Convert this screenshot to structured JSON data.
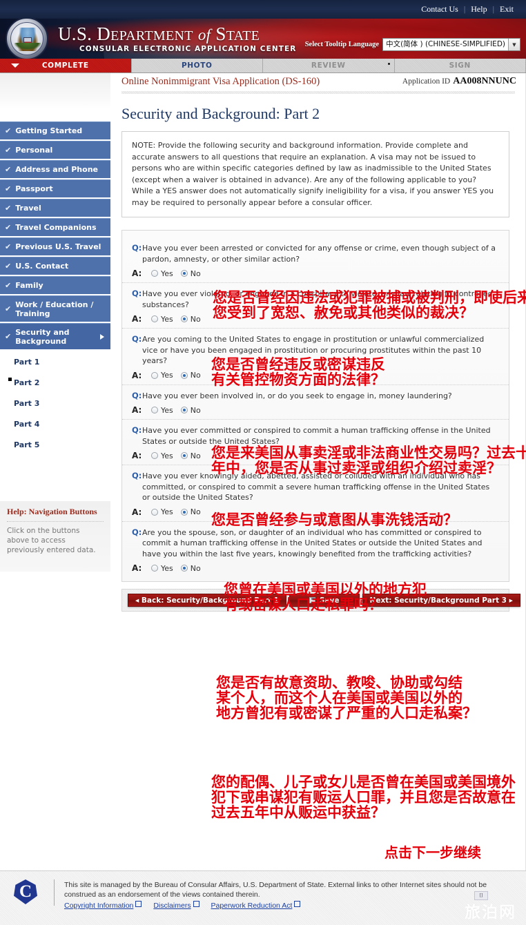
{
  "topbar": {
    "links": [
      "Contact Us",
      "Help",
      "Exit"
    ]
  },
  "banner": {
    "title_prefix": "U.S. D",
    "title_epartment": "EPARTMENT",
    "title_of": "of",
    "title_s": "S",
    "title_tate": "TATE",
    "subtitle": "CONSULAR ELECTRONIC APPLICATION CENTER",
    "language_label": "Select Tooltip Language",
    "language_value": "中文(简体 ) (CHINESE-SIMPLIFIED)"
  },
  "steps": [
    {
      "label": "COMPLETE",
      "state": "active"
    },
    {
      "label": "PHOTO",
      "state": "photo"
    },
    {
      "label": "REVIEW",
      "state": "idle"
    },
    {
      "label": "SIGN",
      "state": "idle"
    }
  ],
  "sidebar": {
    "items": [
      {
        "label": "Getting Started",
        "check": "✔"
      },
      {
        "label": "Personal",
        "check": "✔"
      },
      {
        "label": "Address and Phone",
        "check": "✔"
      },
      {
        "label": "Passport",
        "check": "✔"
      },
      {
        "label": "Travel",
        "check": "✔"
      },
      {
        "label": "Travel Companions",
        "check": "✔"
      },
      {
        "label": "Previous U.S. Travel",
        "check": "✔"
      },
      {
        "label": "U.S. Contact",
        "check": "✔"
      },
      {
        "label": "Family",
        "check": "✔"
      },
      {
        "label": "Work / Education / Training",
        "check": "✔"
      },
      {
        "label": "Security and Background",
        "check": "✔"
      }
    ],
    "subitems": [
      {
        "label": "Part 1",
        "selected": false
      },
      {
        "label": "Part 2",
        "selected": true
      },
      {
        "label": "Part 3",
        "selected": false
      },
      {
        "label": "Part 4",
        "selected": false
      },
      {
        "label": "Part 5",
        "selected": false
      }
    ],
    "help": {
      "title": "Help: Navigation Buttons",
      "text": "Click on the buttons above to access previously entered data."
    }
  },
  "main": {
    "app_title": "Online Nonimmigrant Visa Application (DS-160)",
    "app_id_label": "Application ID",
    "app_id_value": "AA008NNUNC",
    "page_title": "Security and Background: Part 2",
    "note": "NOTE: Provide the following security and background information. Provide complete and accurate answers to all questions that require an explanation. A visa may not be issued to persons who are within specific categories defined by law as inadmissible to the United States (except when a waiver is obtained in advance). Are any of the following applicable to you? While a YES answer does not automatically signify ineligibility for a visa, if you answer YES you may be required to personally appear before a consular officer.",
    "q_label": "Q:",
    "a_label": "A:",
    "yes_label": "Yes",
    "no_label": "No",
    "questions": [
      {
        "text": "Have you ever been arrested or convicted for any offense or crime, even though subject of a pardon, amnesty, or other similar action?",
        "answer": "No",
        "annotation": "您是否曾经因违法或犯罪被捕或被判刑，即使后来\n您受到了宽恕、赦免或其他类似的裁决？"
      },
      {
        "text": "Have you ever violated, or engaged in a conspiracy to violate, any law relating to controlled substances?",
        "answer": "No",
        "annotation": "您是否曾经违反或密谋违反\n有关管控物资方面的法律？"
      },
      {
        "text": "Are you coming to the United States to engage in prostitution or unlawful commercialized vice or have you been engaged in prostitution or procuring prostitutes within the past 10 years?",
        "answer": "No",
        "annotation": "您是来美国从事卖淫或非法商业性交易吗？过去十\n年中，您是否从事过卖淫或组织介绍过卖淫？"
      },
      {
        "text": "Have you ever been involved in, or do you seek to engage in, money laundering?",
        "answer": "No",
        "annotation": "您是否曾经参与或意图从事洗钱活动？"
      },
      {
        "text": "Have you ever committed or conspired to commit a human trafficking offense in the United States or outside the United States?",
        "answer": "No",
        "annotation": "您曾在美国或美国以外的地方犯\n有或密谋人口走私罪吗？"
      },
      {
        "text": "Have you ever knowingly aided, abetted, assisted or colluded with an individual who has committed, or conspired to commit a severe human trafficking offense in the United States or outside the United States?",
        "answer": "No",
        "annotation": "您是否有故意资助、教唆、协助或勾结\n某个人，而这个人在美国或美国以外的\n地方曾犯有或密谋了严重的人口走私案？"
      },
      {
        "text": "Are you the spouse, son, or daughter of an individual who has committed or conspired to commit a human trafficking offense in the United States or outside the United States and have you within the last five years, knowingly benefited from the trafficking activities?",
        "answer": "No",
        "annotation": "您的配偶、儿子或女儿是否曾在美国或美国境外\n犯下或串谋犯有贩运人口罪，并且您是否故意在\n过去五年中从贩运中获益？"
      }
    ],
    "buttons": {
      "back": "◂ Back: Security/Background Part 1",
      "save": "Save",
      "next": "Next: Security/Background Part 3 ▸"
    },
    "next_annotation": "点击下一步继续"
  },
  "footer": {
    "seal_letter": "C",
    "text": "This site is managed by the Bureau of Consular Affairs, U.S. Department of State. External links to other Internet sites should not be construed as an endorsement of the views contained therein.",
    "links": [
      "Copyright Information",
      "Disclaimers",
      "Paperwork Reduction Act"
    ],
    "watermark": "旅泊网",
    "watermark_badge": "[]"
  }
}
